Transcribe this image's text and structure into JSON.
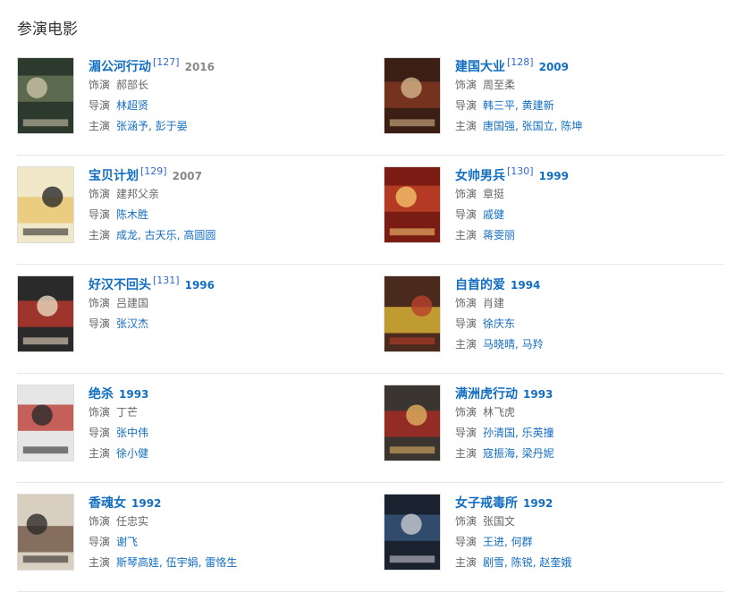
{
  "section": {
    "title": "参演电影"
  },
  "movies": [
    {
      "title": "湄公河行动",
      "ref": "[127]",
      "year": "2016",
      "role_label": "饰演",
      "role": "郝部长",
      "director_label": "导演",
      "directors": [
        "林超贤"
      ],
      "cast_label": "主演",
      "cast": [
        "张涵予",
        "彭于晏"
      ]
    },
    {
      "title": "建国大业",
      "ref": "[128]",
      "year": "2009",
      "role_label": "饰演",
      "role": "周至柔",
      "director_label": "导演",
      "directors": [
        "韩三平",
        "黄建新"
      ],
      "cast_label": "主演",
      "cast": [
        "唐国强",
        "张国立",
        "陈坤"
      ]
    },
    {
      "title": "宝贝计划",
      "ref": "[129]",
      "year": "2007",
      "role_label": "饰演",
      "role": "建邦父亲",
      "director_label": "导演",
      "directors": [
        "陈木胜"
      ],
      "cast_label": "主演",
      "cast": [
        "成龙",
        "古天乐",
        "高圆圆"
      ]
    },
    {
      "title": "女帅男兵",
      "ref": "[130]",
      "year": "1999",
      "role_label": "饰演",
      "role": "章挺",
      "director_label": "导演",
      "directors": [
        "戚健"
      ],
      "cast_label": "主演",
      "cast": [
        "蒋雯丽"
      ]
    },
    {
      "title": "好汉不回头",
      "ref": "[131]",
      "year": "1996",
      "role_label": "饰演",
      "role": "吕建国",
      "director_label": "导演",
      "directors": [
        "张汉杰"
      ],
      "cast_label": "",
      "cast": []
    },
    {
      "title": "自首的爱",
      "ref": "",
      "year": "1994",
      "role_label": "饰演",
      "role": "肖建",
      "director_label": "导演",
      "directors": [
        "徐庆东"
      ],
      "cast_label": "主演",
      "cast": [
        "马晓晴",
        "马羚"
      ]
    },
    {
      "title": "绝杀",
      "ref": "",
      "year": "1993",
      "role_label": "饰演",
      "role": "丁芒",
      "director_label": "导演",
      "directors": [
        "张中伟"
      ],
      "cast_label": "主演",
      "cast": [
        "徐小健"
      ]
    },
    {
      "title": "满洲虎行动",
      "ref": "",
      "year": "1993",
      "role_label": "饰演",
      "role": "林飞虎",
      "director_label": "导演",
      "directors": [
        "孙清国",
        "乐英撞"
      ],
      "cast_label": "主演",
      "cast": [
        "寇振海",
        "梁丹妮"
      ]
    },
    {
      "title": "香魂女",
      "ref": "",
      "year": "1992",
      "role_label": "饰演",
      "role": "任忠实",
      "director_label": "导演",
      "directors": [
        "谢飞"
      ],
      "cast_label": "主演",
      "cast": [
        "斯琴高娃",
        "伍宇娟",
        "雷恪生"
      ]
    },
    {
      "title": "女子戒毒所",
      "ref": "",
      "year": "1992",
      "role_label": "饰演",
      "role": "张国文",
      "director_label": "导演",
      "directors": [
        "王进",
        "何群"
      ],
      "cast_label": "主演",
      "cast": [
        "剧雪",
        "陈锐",
        "赵奎娥"
      ]
    }
  ]
}
